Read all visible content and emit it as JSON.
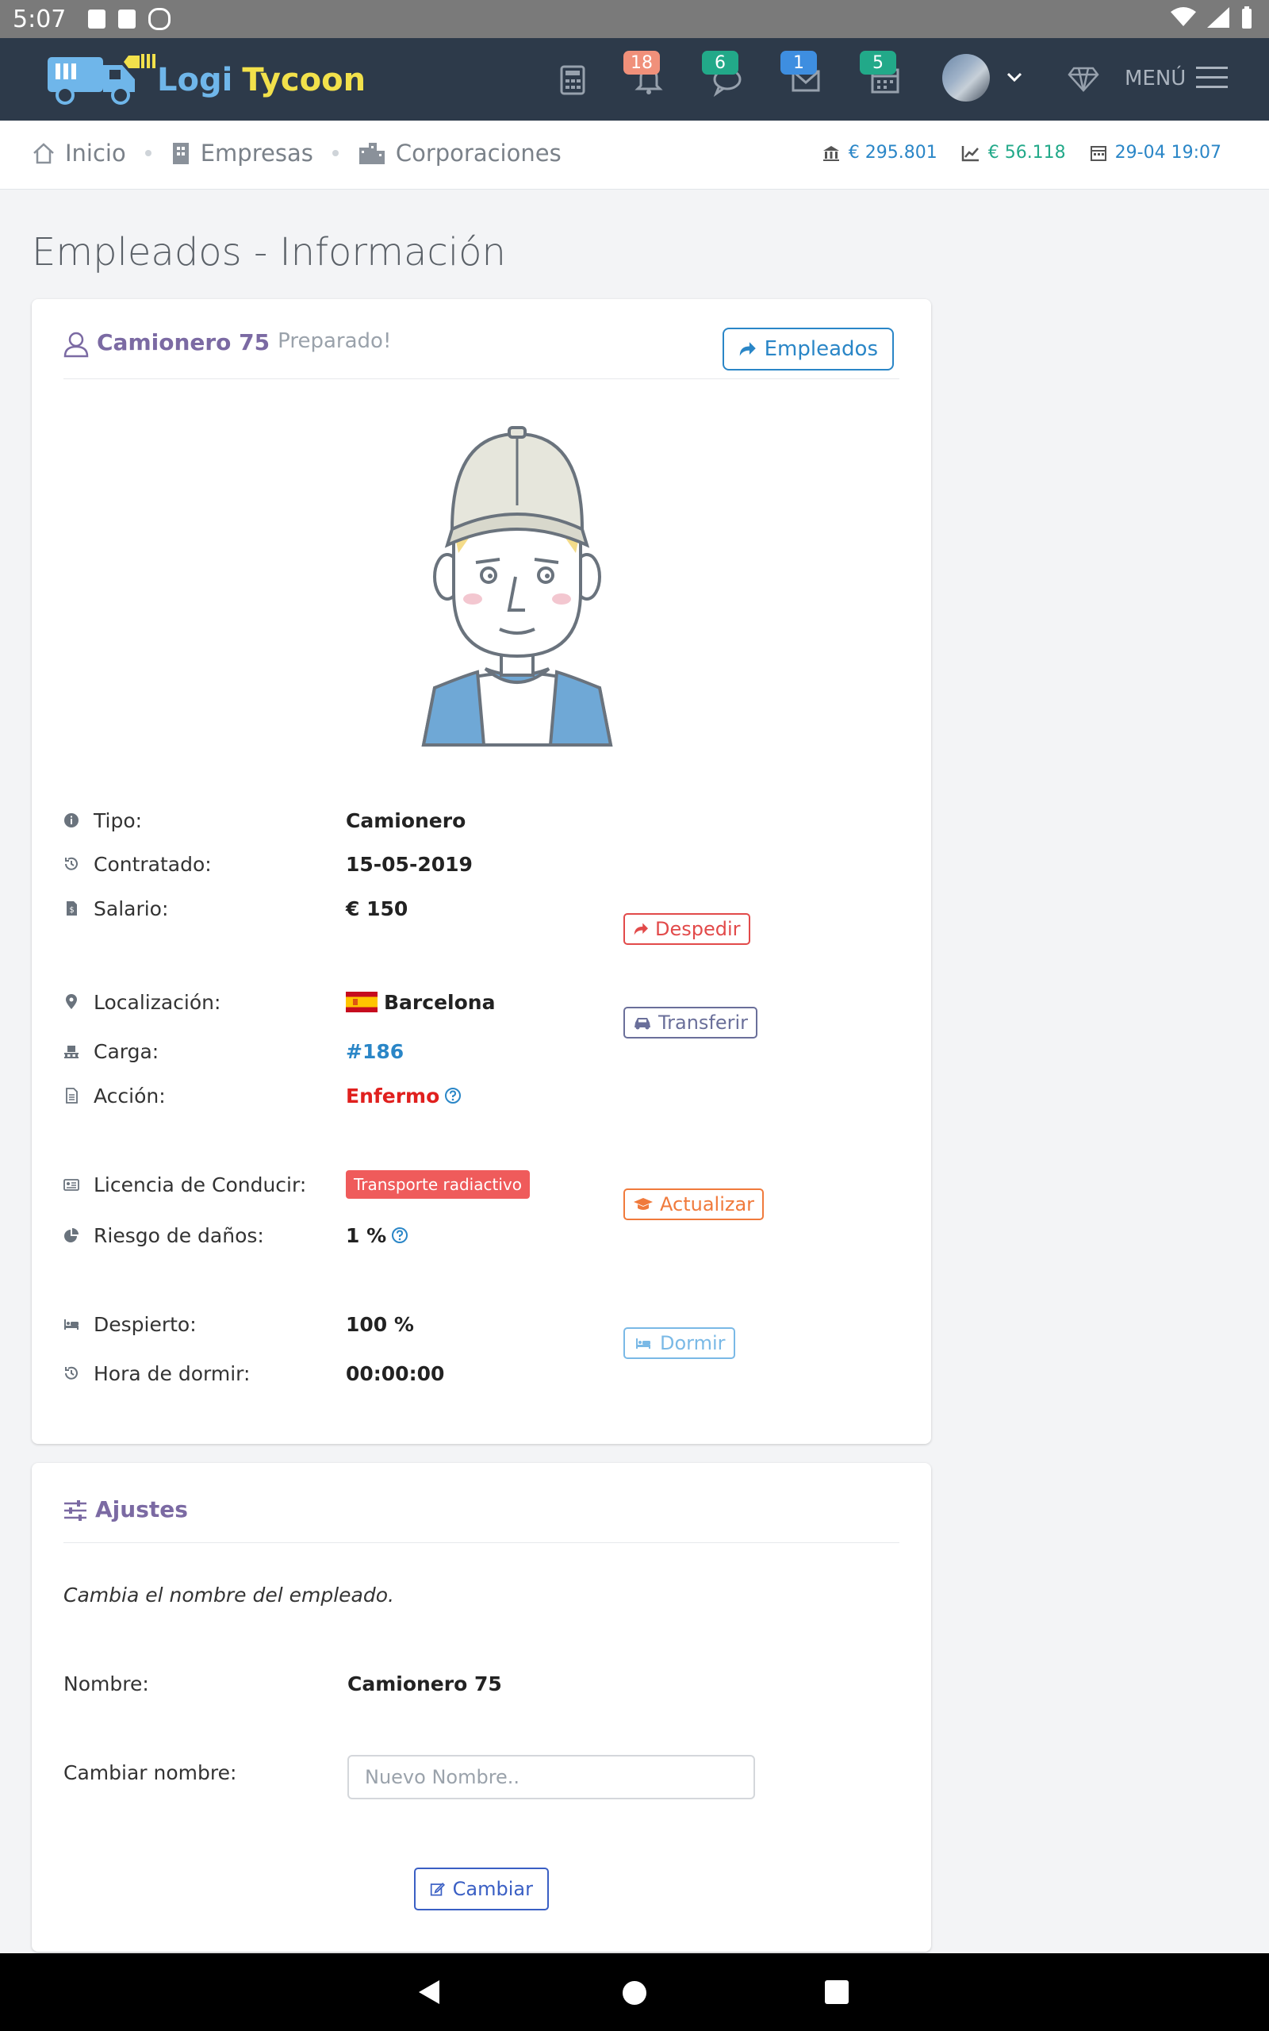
{
  "status_bar": {
    "time": "5:07"
  },
  "nav": {
    "brand_part1": "Logi",
    "brand_part2": "Tycoon",
    "notifications_count": "18",
    "messages_count": "6",
    "mail_count": "1",
    "calendar_count": "5",
    "menu_label": "MENÚ"
  },
  "breadcrumb": {
    "items": [
      "Inicio",
      "Empresas",
      "Corporaciones"
    ],
    "bank": "€ 295.801",
    "profit": "€ 56.118",
    "datetime": "29-04 19:07"
  },
  "page": {
    "title": "Empleados - Información"
  },
  "employee": {
    "name": "Camionero 75",
    "status": "Preparado!",
    "employees_button": "Empleados",
    "rows": {
      "tipo_label": "Tipo:",
      "tipo_value": "Camionero",
      "contratado_label": "Contratado:",
      "contratado_value": "15-05-2019",
      "salario_label": "Salario:",
      "salario_value": "€ 150",
      "despedir": "Despedir",
      "localizacion_label": "Localización:",
      "localizacion_value": "Barcelona",
      "transferir": "Transferir",
      "carga_label": "Carga:",
      "carga_value": "#186",
      "accion_label": "Acción:",
      "accion_value": "Enfermo",
      "licencia_label": "Licencia de Conducir:",
      "licencia_value": "Transporte radiactivo",
      "actualizar": "Actualizar",
      "riesgo_label": "Riesgo de daños:",
      "riesgo_value": "1 %",
      "despierto_label": "Despierto:",
      "despierto_value": "100 %",
      "dormir": "Dormir",
      "hora_label": "Hora de dormir:",
      "hora_value": "00:00:00"
    }
  },
  "settings": {
    "title": "Ajustes",
    "description": "Cambia el nombre del empleado.",
    "nombre_label": "Nombre:",
    "nombre_value": "Camionero 75",
    "cambiar_label": "Cambiar nombre:",
    "input_placeholder": "Nuevo Nombre..",
    "cambiar_button": "Cambiar"
  },
  "colors": {
    "navbar": "#2d3a4a",
    "accent_blue": "#2a86c7",
    "red": "#e24a4a",
    "purple": "#7b6aa3",
    "orange": "#f07a3c"
  }
}
